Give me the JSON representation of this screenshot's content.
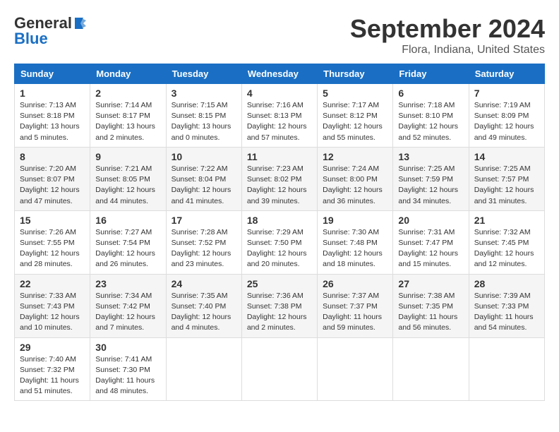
{
  "logo": {
    "general": "General",
    "blue": "Blue"
  },
  "title": "September 2024",
  "location": "Flora, Indiana, United States",
  "headers": [
    "Sunday",
    "Monday",
    "Tuesday",
    "Wednesday",
    "Thursday",
    "Friday",
    "Saturday"
  ],
  "weeks": [
    [
      {
        "day": "1",
        "sunrise": "Sunrise: 7:13 AM",
        "sunset": "Sunset: 8:18 PM",
        "daylight": "Daylight: 13 hours and 5 minutes."
      },
      {
        "day": "2",
        "sunrise": "Sunrise: 7:14 AM",
        "sunset": "Sunset: 8:17 PM",
        "daylight": "Daylight: 13 hours and 2 minutes."
      },
      {
        "day": "3",
        "sunrise": "Sunrise: 7:15 AM",
        "sunset": "Sunset: 8:15 PM",
        "daylight": "Daylight: 13 hours and 0 minutes."
      },
      {
        "day": "4",
        "sunrise": "Sunrise: 7:16 AM",
        "sunset": "Sunset: 8:13 PM",
        "daylight": "Daylight: 12 hours and 57 minutes."
      },
      {
        "day": "5",
        "sunrise": "Sunrise: 7:17 AM",
        "sunset": "Sunset: 8:12 PM",
        "daylight": "Daylight: 12 hours and 55 minutes."
      },
      {
        "day": "6",
        "sunrise": "Sunrise: 7:18 AM",
        "sunset": "Sunset: 8:10 PM",
        "daylight": "Daylight: 12 hours and 52 minutes."
      },
      {
        "day": "7",
        "sunrise": "Sunrise: 7:19 AM",
        "sunset": "Sunset: 8:09 PM",
        "daylight": "Daylight: 12 hours and 49 minutes."
      }
    ],
    [
      {
        "day": "8",
        "sunrise": "Sunrise: 7:20 AM",
        "sunset": "Sunset: 8:07 PM",
        "daylight": "Daylight: 12 hours and 47 minutes."
      },
      {
        "day": "9",
        "sunrise": "Sunrise: 7:21 AM",
        "sunset": "Sunset: 8:05 PM",
        "daylight": "Daylight: 12 hours and 44 minutes."
      },
      {
        "day": "10",
        "sunrise": "Sunrise: 7:22 AM",
        "sunset": "Sunset: 8:04 PM",
        "daylight": "Daylight: 12 hours and 41 minutes."
      },
      {
        "day": "11",
        "sunrise": "Sunrise: 7:23 AM",
        "sunset": "Sunset: 8:02 PM",
        "daylight": "Daylight: 12 hours and 39 minutes."
      },
      {
        "day": "12",
        "sunrise": "Sunrise: 7:24 AM",
        "sunset": "Sunset: 8:00 PM",
        "daylight": "Daylight: 12 hours and 36 minutes."
      },
      {
        "day": "13",
        "sunrise": "Sunrise: 7:25 AM",
        "sunset": "Sunset: 7:59 PM",
        "daylight": "Daylight: 12 hours and 34 minutes."
      },
      {
        "day": "14",
        "sunrise": "Sunrise: 7:25 AM",
        "sunset": "Sunset: 7:57 PM",
        "daylight": "Daylight: 12 hours and 31 minutes."
      }
    ],
    [
      {
        "day": "15",
        "sunrise": "Sunrise: 7:26 AM",
        "sunset": "Sunset: 7:55 PM",
        "daylight": "Daylight: 12 hours and 28 minutes."
      },
      {
        "day": "16",
        "sunrise": "Sunrise: 7:27 AM",
        "sunset": "Sunset: 7:54 PM",
        "daylight": "Daylight: 12 hours and 26 minutes."
      },
      {
        "day": "17",
        "sunrise": "Sunrise: 7:28 AM",
        "sunset": "Sunset: 7:52 PM",
        "daylight": "Daylight: 12 hours and 23 minutes."
      },
      {
        "day": "18",
        "sunrise": "Sunrise: 7:29 AM",
        "sunset": "Sunset: 7:50 PM",
        "daylight": "Daylight: 12 hours and 20 minutes."
      },
      {
        "day": "19",
        "sunrise": "Sunrise: 7:30 AM",
        "sunset": "Sunset: 7:48 PM",
        "daylight": "Daylight: 12 hours and 18 minutes."
      },
      {
        "day": "20",
        "sunrise": "Sunrise: 7:31 AM",
        "sunset": "Sunset: 7:47 PM",
        "daylight": "Daylight: 12 hours and 15 minutes."
      },
      {
        "day": "21",
        "sunrise": "Sunrise: 7:32 AM",
        "sunset": "Sunset: 7:45 PM",
        "daylight": "Daylight: 12 hours and 12 minutes."
      }
    ],
    [
      {
        "day": "22",
        "sunrise": "Sunrise: 7:33 AM",
        "sunset": "Sunset: 7:43 PM",
        "daylight": "Daylight: 12 hours and 10 minutes."
      },
      {
        "day": "23",
        "sunrise": "Sunrise: 7:34 AM",
        "sunset": "Sunset: 7:42 PM",
        "daylight": "Daylight: 12 hours and 7 minutes."
      },
      {
        "day": "24",
        "sunrise": "Sunrise: 7:35 AM",
        "sunset": "Sunset: 7:40 PM",
        "daylight": "Daylight: 12 hours and 4 minutes."
      },
      {
        "day": "25",
        "sunrise": "Sunrise: 7:36 AM",
        "sunset": "Sunset: 7:38 PM",
        "daylight": "Daylight: 12 hours and 2 minutes."
      },
      {
        "day": "26",
        "sunrise": "Sunrise: 7:37 AM",
        "sunset": "Sunset: 7:37 PM",
        "daylight": "Daylight: 11 hours and 59 minutes."
      },
      {
        "day": "27",
        "sunrise": "Sunrise: 7:38 AM",
        "sunset": "Sunset: 7:35 PM",
        "daylight": "Daylight: 11 hours and 56 minutes."
      },
      {
        "day": "28",
        "sunrise": "Sunrise: 7:39 AM",
        "sunset": "Sunset: 7:33 PM",
        "daylight": "Daylight: 11 hours and 54 minutes."
      }
    ],
    [
      {
        "day": "29",
        "sunrise": "Sunrise: 7:40 AM",
        "sunset": "Sunset: 7:32 PM",
        "daylight": "Daylight: 11 hours and 51 minutes."
      },
      {
        "day": "30",
        "sunrise": "Sunrise: 7:41 AM",
        "sunset": "Sunset: 7:30 PM",
        "daylight": "Daylight: 11 hours and 48 minutes."
      },
      null,
      null,
      null,
      null,
      null
    ]
  ]
}
